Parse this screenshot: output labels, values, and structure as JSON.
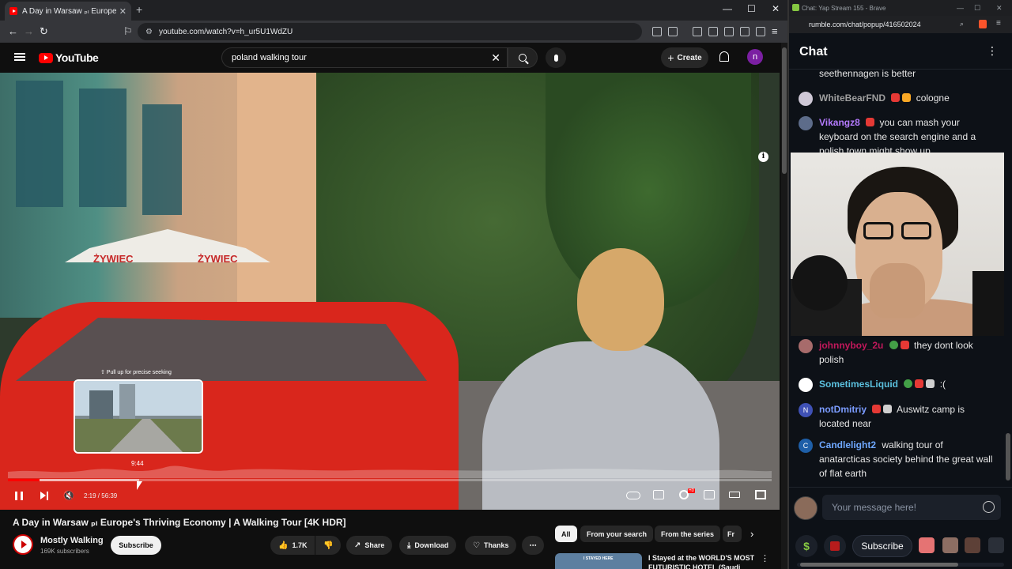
{
  "browser": {
    "tab_title": "A Day in Warsaw ₚₗ Europe's Thriving",
    "url": "youtube.com/watch?v=h_ur5U1WdZU"
  },
  "youtube": {
    "logo_text": "YouTube",
    "search_value": "poland walking tour",
    "create_label": "Create",
    "avatar_letter": "n",
    "video": {
      "seek_hint": "⇧ Pull up for precise seeking",
      "preview_time": "9:44",
      "timecode": "2:19 / 56:39",
      "progress": 0.041,
      "hover": 0.172,
      "umbrella_brand": "ŻYWIEC"
    },
    "title": "A Day in Warsaw ₚₗ Europe's Thriving Economy | A Walking Tour [4K HDR]",
    "channel": {
      "name": "Mostly Walking",
      "subscribers": "169K subscribers",
      "subscribe_label": "Subscribe"
    },
    "actions": {
      "likes": "1.7K",
      "share": "Share",
      "download": "Download",
      "thanks": "Thanks"
    },
    "chips": [
      "All",
      "From your search",
      "From the series",
      "Fr"
    ],
    "recommended": {
      "title": "I Stayed at the WORLD'S MOST FUTURISTIC HOTEL (Saudi",
      "thumb_label": "I STAYED HERE"
    }
  },
  "rumble": {
    "window_title": "Chat: Yap Stream 155 - Brave",
    "url": "rumble.com/chat/popup/416502024",
    "header": "Chat",
    "messages_top": [
      {
        "user": "",
        "text": "seethennagen is better",
        "color": "#e6e6e6"
      },
      {
        "user": "WhiteBearFND",
        "text": "cologne",
        "color": "#9e9e9e"
      },
      {
        "user": "Vikangz8",
        "text": "you can mash your keyboard on the search engine and a polish town might show up",
        "color": "#b57bff"
      }
    ],
    "messages_bottom": [
      {
        "user": "johnnyboy_2u",
        "text": "they dont look polish",
        "color": "#c2185b"
      },
      {
        "user": "SometimesLiquid",
        "text": ":(",
        "color": "#5bc0de"
      },
      {
        "user": "notDmitriy",
        "text": "Auswitz camp is located near",
        "color": "#7b9cff"
      },
      {
        "user": "Candlelight2",
        "text": "walking tour of anatarcticas society behind the great wall of flat earth",
        "color": "#6fa8ff"
      }
    ],
    "message_placeholder": "Your message here!",
    "subscribe_label": "Subscribe",
    "coin_symbol": "$"
  }
}
